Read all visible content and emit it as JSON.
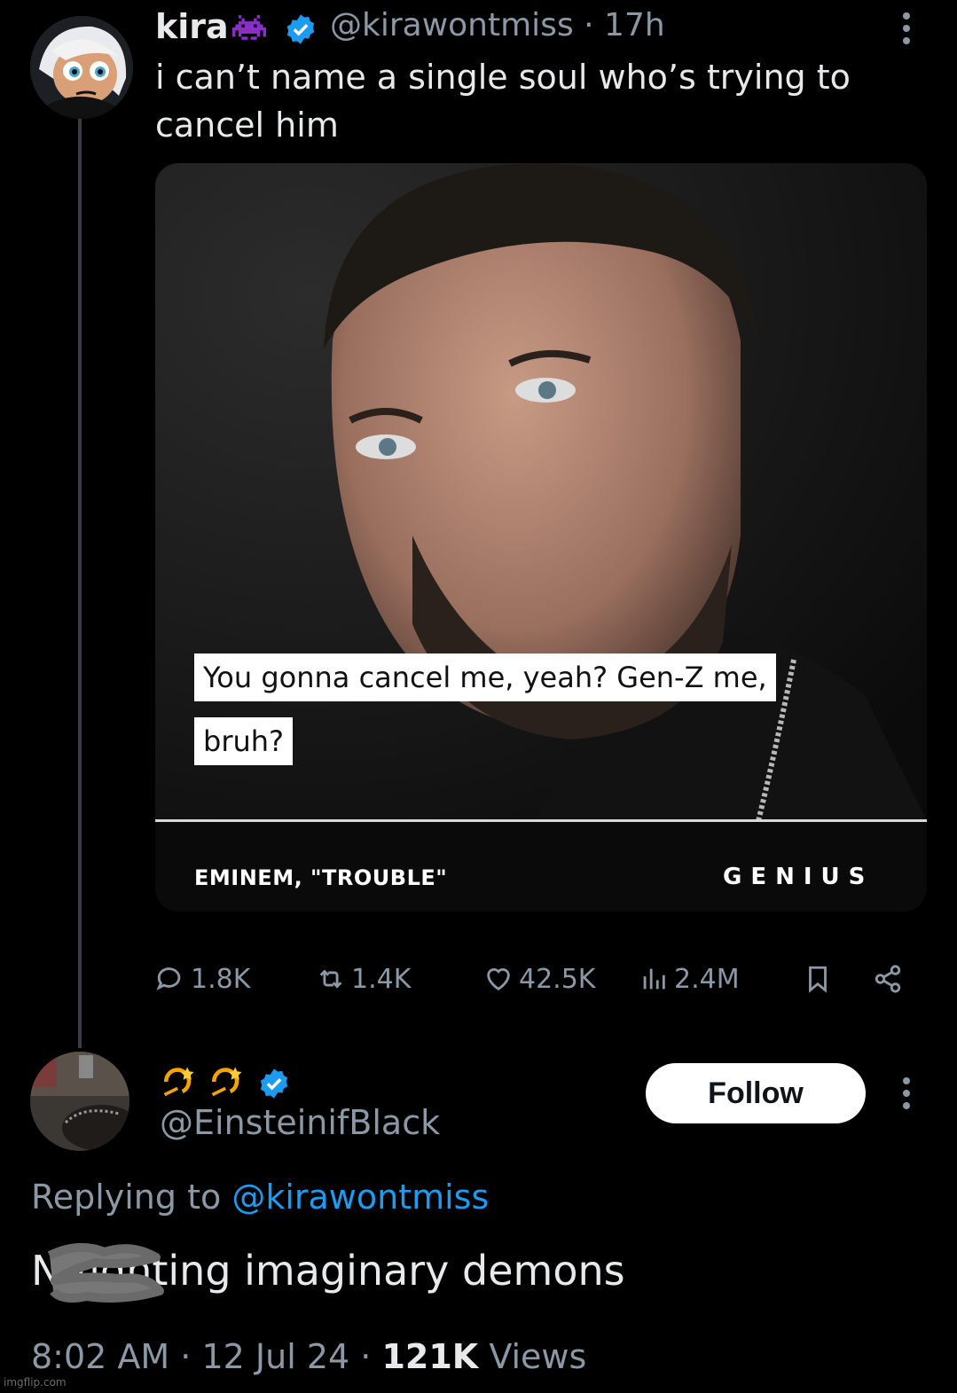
{
  "tweet": {
    "name": "kira",
    "handle": "@kirawontmiss",
    "time": "17h",
    "text": "i can’t name a single soul who’s trying to cancel him",
    "name_icon": "alien-monster-icon",
    "verified_color": "#1d9bf0",
    "media": {
      "caption_line1": "You gonna cancel me, yeah? Gen-Z me,",
      "caption_line2": "bruh?",
      "credit": "EMINEM, \"TROUBLE\"",
      "brand": "GENIUS"
    },
    "actions": {
      "replies": "1.8K",
      "retweets": "1.4K",
      "likes": "42.5K",
      "views": "2.4M"
    }
  },
  "reply": {
    "display_name_icons": [
      "dizzy-icon",
      "dizzy-icon"
    ],
    "handle": "@EinsteinifBlack",
    "follow_label": "Follow",
    "replying_prefix": "Replying to",
    "replying_to": "@kirawontmiss",
    "text": "N fighting imaginary demons",
    "time": "8:02 AM",
    "date": "12 Jul 24",
    "views_count": "121K",
    "views_label": "Views"
  },
  "watermark": "imgflip.com",
  "colors": {
    "background": "#000000",
    "text_primary": "#e7e9ea",
    "text_secondary": "#8b98a5",
    "link": "#1d9bf0"
  }
}
